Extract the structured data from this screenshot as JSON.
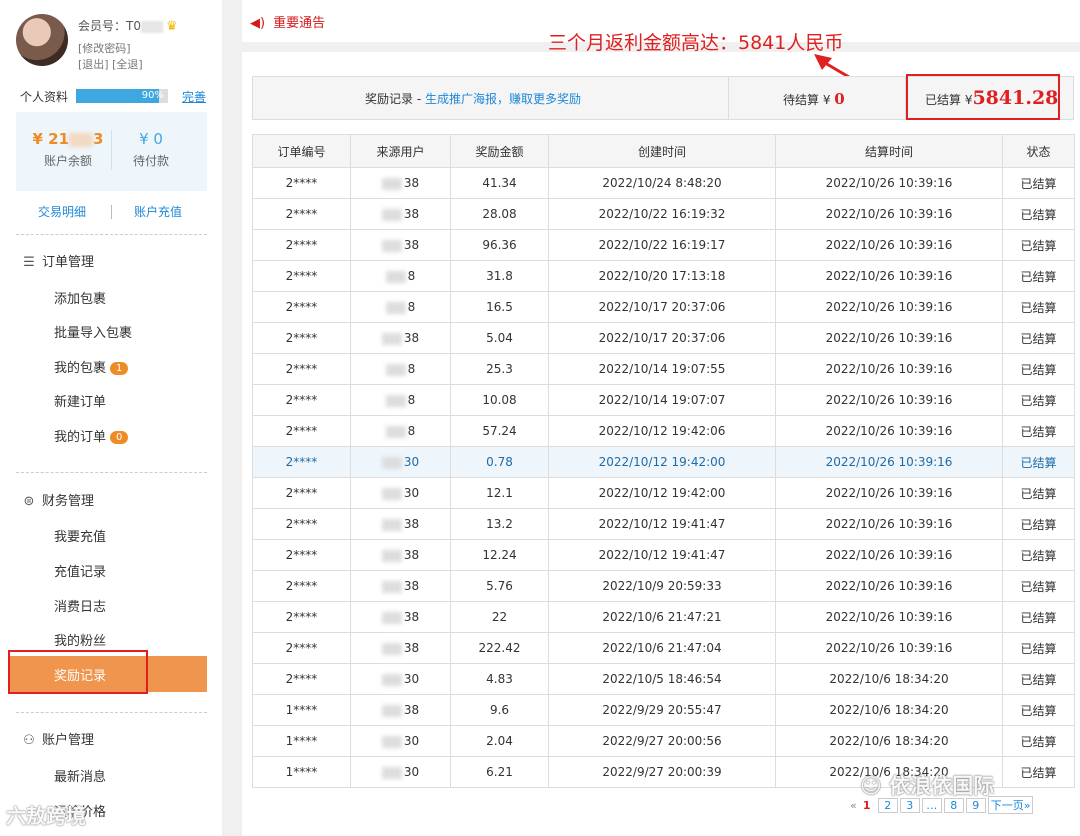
{
  "sidebar": {
    "member_label": "会员号：T0",
    "change_password": "[修改密码]",
    "logout_links": "[退出] [全退]",
    "profile_label": "个人资料",
    "profile_progress": 0.9,
    "profile_progress_text": "90%",
    "complete_link": "完善",
    "balance_amount": "¥ 21",
    "balance_amount_tail": "3",
    "balance_label": "账户余额",
    "pending_amount": "¥ 0",
    "pending_label": "待付款",
    "transactions_link": "交易明细",
    "recharge_link": "账户充值",
    "sections": {
      "orders": {
        "title": "订单管理",
        "items": [
          "添加包裹",
          "批量导入包裹",
          "我的包裹",
          "新建订单",
          "我的订单"
        ],
        "badge_packages": "1",
        "badge_orders": "0"
      },
      "finance": {
        "title": "财务管理",
        "items": [
          "我要充值",
          "充值记录",
          "消费日志",
          "我的粉丝"
        ],
        "active_item": "奖励记录"
      },
      "account": {
        "title": "账户管理",
        "items": [
          "最新消息",
          "运输价格"
        ]
      }
    },
    "watermark": "六敖跨境"
  },
  "main": {
    "notice": "重要通告",
    "annotation": "三个月返利金额高达：5841人民币",
    "summary": {
      "title": "奖励记录 - ",
      "link": "生成推广海报，赚取更多奖励",
      "pending_label": "待结算 ¥",
      "pending_value": "0",
      "settled_label": "已结算 ¥",
      "settled_value": "5841.28"
    },
    "table": {
      "headers": [
        "订单编号",
        "来源用户",
        "奖励金额",
        "创建时间",
        "结算时间",
        "状态"
      ],
      "rows": [
        [
          "2****",
          "38",
          "41.34",
          "2022/10/24 8:48:20",
          "2022/10/26 10:39:16",
          "已结算"
        ],
        [
          "2****",
          "38",
          "28.08",
          "2022/10/22 16:19:32",
          "2022/10/26 10:39:16",
          "已结算"
        ],
        [
          "2****",
          "38",
          "96.36",
          "2022/10/22 16:19:17",
          "2022/10/26 10:39:16",
          "已结算"
        ],
        [
          "2****",
          "8",
          "31.8",
          "2022/10/20 17:13:18",
          "2022/10/26 10:39:16",
          "已结算"
        ],
        [
          "2****",
          "8",
          "16.5",
          "2022/10/17 20:37:06",
          "2022/10/26 10:39:16",
          "已结算"
        ],
        [
          "2****",
          "38",
          "5.04",
          "2022/10/17 20:37:06",
          "2022/10/26 10:39:16",
          "已结算"
        ],
        [
          "2****",
          "8",
          "25.3",
          "2022/10/14 19:07:55",
          "2022/10/26 10:39:16",
          "已结算"
        ],
        [
          "2****",
          "8",
          "10.08",
          "2022/10/14 19:07:07",
          "2022/10/26 10:39:16",
          "已结算"
        ],
        [
          "2****",
          "8",
          "57.24",
          "2022/10/12 19:42:06",
          "2022/10/26 10:39:16",
          "已结算"
        ],
        [
          "2****",
          "30",
          "0.78",
          "2022/10/12 19:42:00",
          "2022/10/26 10:39:16",
          "已结算"
        ],
        [
          "2****",
          "30",
          "12.1",
          "2022/10/12 19:42:00",
          "2022/10/26 10:39:16",
          "已结算"
        ],
        [
          "2****",
          "38",
          "13.2",
          "2022/10/12 19:41:47",
          "2022/10/26 10:39:16",
          "已结算"
        ],
        [
          "2****",
          "38",
          "12.24",
          "2022/10/12 19:41:47",
          "2022/10/26 10:39:16",
          "已结算"
        ],
        [
          "2****",
          "38",
          "5.76",
          "2022/10/9 20:59:33",
          "2022/10/26 10:39:16",
          "已结算"
        ],
        [
          "2****",
          "38",
          "22",
          "2022/10/6 21:47:21",
          "2022/10/26 10:39:16",
          "已结算"
        ],
        [
          "2****",
          "38",
          "222.42",
          "2022/10/6 21:47:04",
          "2022/10/26 10:39:16",
          "已结算"
        ],
        [
          "2****",
          "30",
          "4.83",
          "2022/10/5 18:46:54",
          "2022/10/6 18:34:20",
          "已结算"
        ],
        [
          "1****",
          "38",
          "9.6",
          "2022/9/29 20:55:47",
          "2022/10/6 18:34:20",
          "已结算"
        ],
        [
          "1****",
          "30",
          "2.04",
          "2022/9/27 20:00:56",
          "2022/10/6 18:34:20",
          "已结算"
        ],
        [
          "1****",
          "30",
          "6.21",
          "2022/9/27 20:00:39",
          "2022/10/6 18:34:20",
          "已结算"
        ]
      ],
      "highlighted_row": 9
    },
    "pagination": {
      "prev": "«",
      "pages": [
        "1",
        "2",
        "3",
        "…",
        "8",
        "9"
      ],
      "current": "1",
      "next": "下一页»"
    },
    "watermark": "依浪依国际"
  }
}
